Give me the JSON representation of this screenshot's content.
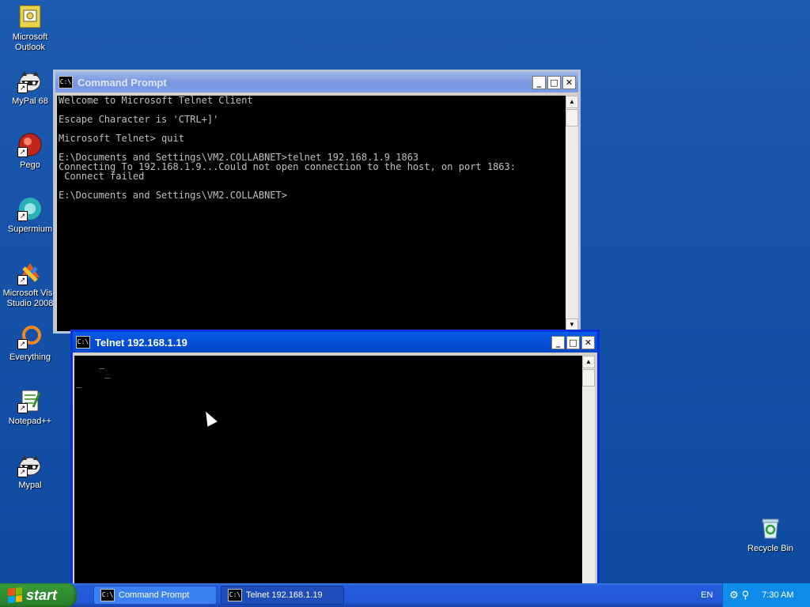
{
  "desktop": {
    "icons": [
      {
        "label": "Microsoft\nOutlook",
        "icon": "outlook-icon"
      },
      {
        "label": "MyPal 68",
        "icon": "mypal-raccoon-icon"
      },
      {
        "label": "Pego",
        "icon": "pego-icon"
      },
      {
        "label": "Supermium",
        "icon": "supermium-icon"
      },
      {
        "label": "Microsoft Visu\nStudio 2008",
        "icon": "visual-studio-icon"
      },
      {
        "label": "Everything",
        "icon": "everything-icon"
      },
      {
        "label": "Notepad++",
        "icon": "notepad-plus-plus-icon"
      },
      {
        "label": "Mypal",
        "icon": "mypal-raccoon-icon"
      },
      {
        "label": "Recycle Bin",
        "icon": "recycle-bin-icon"
      }
    ]
  },
  "cmd_window": {
    "title": "Command Prompt",
    "console_text": "Welcome to Microsoft Telnet Client\n\nEscape Character is 'CTRL+]'\n\nMicrosoft Telnet> quit\n\nE:\\Documents and Settings\\VM2.COLLABNET>telnet 192.168.1.9 1863\nConnecting To 192.168.1.9...Could not open connection to the host, on port 1863:\n Connect failed\n\nE:\\Documents and Settings\\VM2.COLLABNET>"
  },
  "telnet_window": {
    "title": "Telnet 192.168.1.19",
    "console_text": "    _\n     _\n_"
  },
  "taskbar": {
    "start_label": "start",
    "buttons": [
      {
        "label": "Command Prompt",
        "active": false
      },
      {
        "label": "Telnet 192.168.1.19",
        "active": true
      }
    ],
    "language": "EN",
    "clock": "7:30 AM"
  },
  "colors": {
    "desktop": "#1653a9",
    "active_title": "#0450d8",
    "inactive_title": "#7a96df",
    "console_bg": "#000000",
    "console_text": "#c0c0c0"
  }
}
